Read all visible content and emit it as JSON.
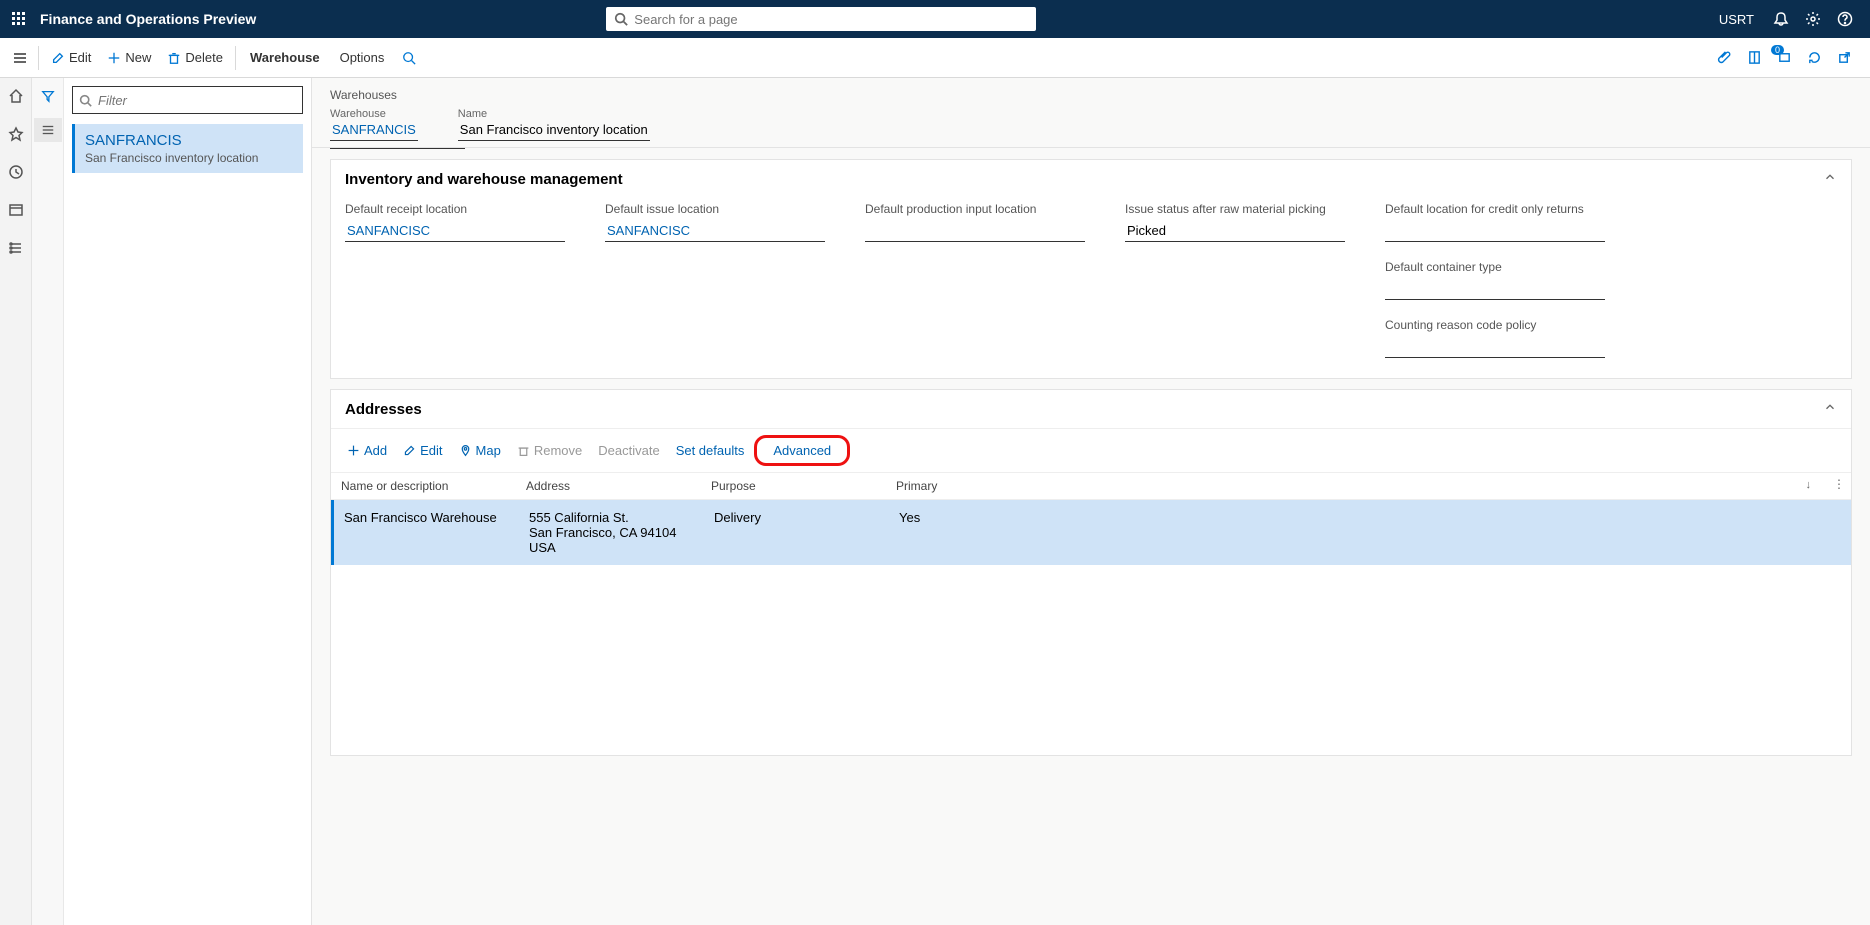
{
  "topbar": {
    "title": "Finance and Operations Preview",
    "search_placeholder": "Search for a page",
    "company": "USRT"
  },
  "actionbar": {
    "edit": "Edit",
    "new": "New",
    "delete": "Delete",
    "warehouse_tab": "Warehouse",
    "options_tab": "Options",
    "alert_count": "0"
  },
  "list": {
    "filter_placeholder": "Filter",
    "item_code": "SANFRANCIS",
    "item_desc": "San Francisco inventory location"
  },
  "header": {
    "crumb": "Warehouses",
    "warehouse_label": "Warehouse",
    "warehouse_value": "SANFRANCIS",
    "name_label": "Name",
    "name_value": "San Francisco inventory location"
  },
  "inv_section": {
    "title": "Inventory and warehouse management",
    "default_receipt_label": "Default receipt location",
    "default_receipt_value": "SANFANCISC",
    "default_issue_label": "Default issue location",
    "default_issue_value": "SANFANCISC",
    "default_prod_label": "Default production input location",
    "default_prod_value": "",
    "issue_status_label": "Issue status after raw material picking",
    "issue_status_value": "Picked",
    "credit_return_label": "Default location for credit only returns",
    "credit_return_value": "",
    "container_type_label": "Default container type",
    "container_type_value": "",
    "reason_code_label": "Counting reason code policy",
    "reason_code_value": ""
  },
  "addresses": {
    "title": "Addresses",
    "add": "Add",
    "edit": "Edit",
    "map": "Map",
    "remove": "Remove",
    "deactivate": "Deactivate",
    "set_defaults": "Set defaults",
    "advanced": "Advanced",
    "col_name": "Name or description",
    "col_address": "Address",
    "col_purpose": "Purpose",
    "col_primary": "Primary",
    "row": {
      "name": "San Francisco Warehouse",
      "address": "555 California St.\nSan Francisco, CA 94104\nUSA",
      "purpose": "Delivery",
      "primary": "Yes"
    }
  }
}
